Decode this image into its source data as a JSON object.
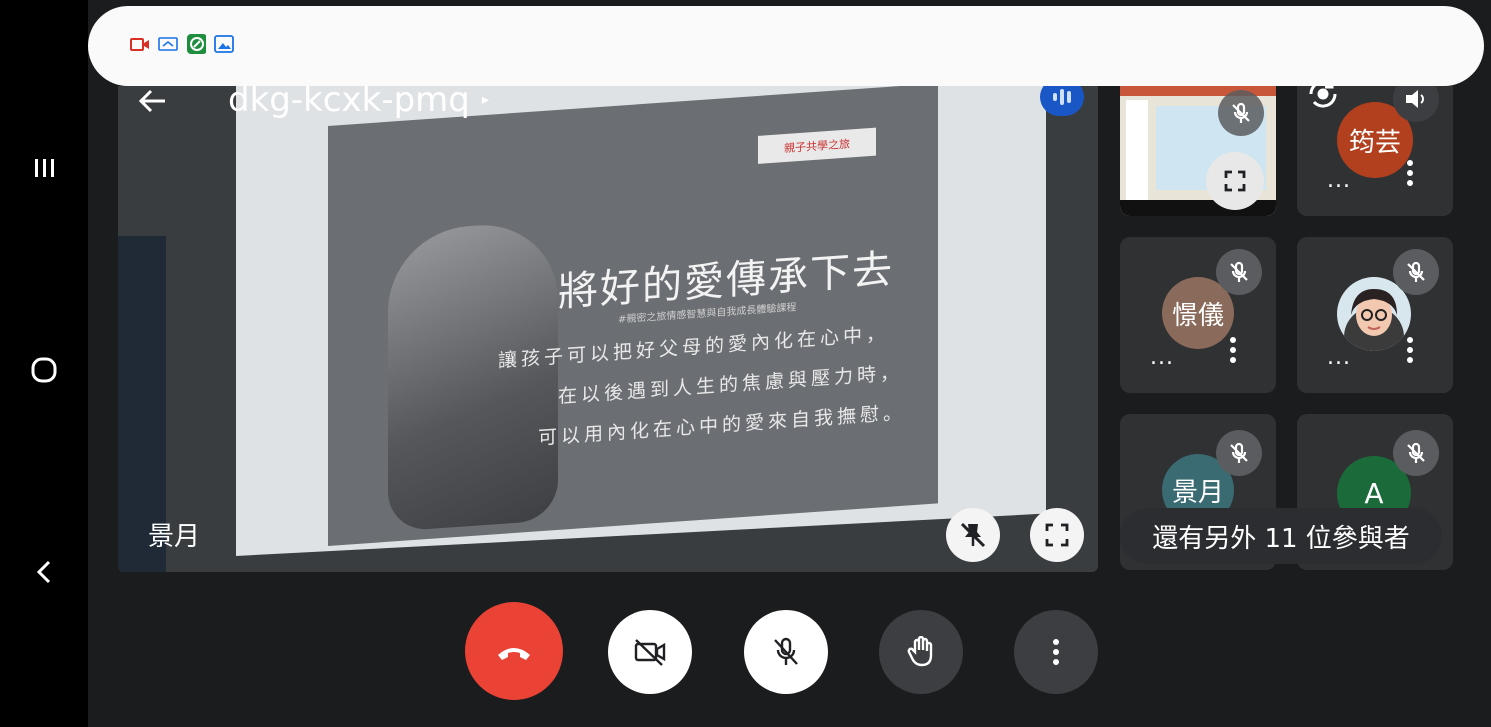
{
  "header": {
    "meeting_code": "dkg-kcxk-pmq",
    "caret": "▸"
  },
  "notification_icons": [
    "video-record-icon",
    "screen-cast-icon",
    "green-app-icon",
    "gallery-icon"
  ],
  "main_video": {
    "participant_name": "景月",
    "slide": {
      "logo_text": "親子共學之旅",
      "title": "將好的愛傳承下去",
      "subtitle": "#親密之旅情感智慧與自我成長體驗課程",
      "lines": [
        "讓孩子可以把好父母的愛內化在心中，",
        "在以後遇到人生的焦慮與壓力時，",
        "可以用內化在心中的愛來自我撫慰。"
      ]
    }
  },
  "tiles": [
    {
      "id": "screen-share",
      "name": "",
      "avatar_text": ""
    },
    {
      "id": "yiyun",
      "name": "...",
      "avatar_text": "筠芸",
      "avatar_color": "#b2401f"
    },
    {
      "id": "jingyi",
      "name": "...",
      "avatar_text": "憬儀",
      "avatar_color": "#8a6a5b"
    },
    {
      "id": "cartoon",
      "name": "...",
      "avatar_text": ""
    },
    {
      "id": "jingyue",
      "name": "",
      "avatar_text": "景月",
      "avatar_color": "#3a6b73"
    },
    {
      "id": "a",
      "name": "",
      "avatar_text": "A",
      "avatar_color": "#1b6b3a"
    }
  ],
  "others_label": "還有另外 11 位參與者",
  "controls": {
    "hangup": "hang-up",
    "camera": "camera-off",
    "mic": "mic-off",
    "hand": "raise-hand",
    "more": "more-options"
  },
  "colors": {
    "hangup_red": "#ea4335",
    "speaking_blue": "#1a57c6",
    "app_bg": "#1b1c1e"
  }
}
